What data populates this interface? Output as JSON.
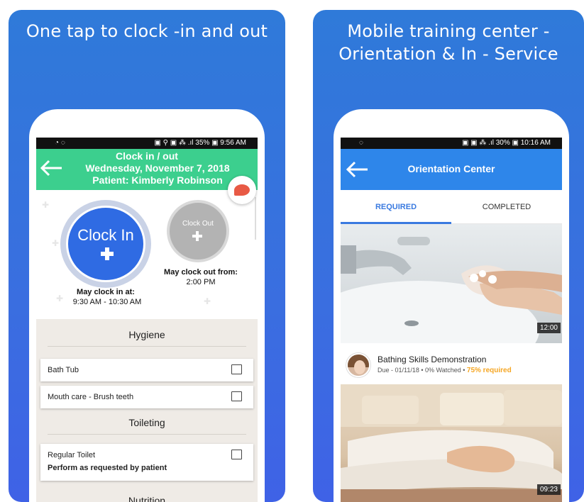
{
  "left_panel": {
    "title": "One tap to clock -in and out",
    "status_bar": {
      "left": "◔ ◌",
      "right": "▣ ⚲ ▣ ⁂ .ıl 35% ▣ 9:56 AM"
    },
    "header": {
      "line1": "Clock in / out",
      "line2": "Wednesday, November 7, 2018",
      "line3": "Patient: Kimberly Robinson"
    },
    "clock_in": {
      "label": "Clock In",
      "note_label": "May clock in at:",
      "note_value": "9:30 AM - 10:30 AM"
    },
    "clock_out": {
      "label": "Clock Out",
      "note_label": "May clock out from:",
      "note_value": "2:00 PM"
    },
    "sections": [
      {
        "title": "Hygiene"
      },
      {
        "title": "Toileting"
      },
      {
        "title": "Nutrition"
      }
    ],
    "tasks": [
      {
        "label": "Bath Tub",
        "checked": false
      },
      {
        "label": "Mouth care - Brush teeth",
        "checked": false
      },
      {
        "label": "Regular Toilet",
        "sub": "Perform as requested by patient",
        "checked": false
      }
    ]
  },
  "right_panel": {
    "title_line1": "Mobile training center -",
    "title_line2": "Orientation & In - Service",
    "status_bar": {
      "left": "◌",
      "right": "▣ ▣ ⁂ .ıl 30% ▣ 10:16 AM"
    },
    "header_title": "Orientation Center",
    "tabs": [
      {
        "label": "REQUIRED",
        "active": true
      },
      {
        "label": "COMPLETED",
        "active": false
      }
    ],
    "videos": [
      {
        "duration": "12:00",
        "title": "Bathing Skills Demonstration",
        "meta": "Due - 01/11/18 • 0% Watched •",
        "required": "75% required"
      },
      {
        "duration": "09:23"
      }
    ]
  },
  "colors": {
    "panel_blue": "#3a6ee0",
    "clock_header_green": "#3ccf8e",
    "clock_in_blue": "#2f6be3",
    "orient_header_blue": "#2e86ea",
    "required_orange": "#f5a623"
  },
  "icons": [
    "back-arrow-icon",
    "chat-bubble-icon",
    "plus-icon",
    "checkbox-icon",
    "avatar"
  ]
}
